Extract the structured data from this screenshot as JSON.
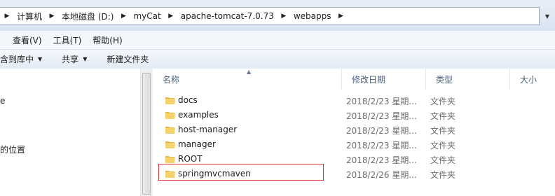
{
  "address_bar": {
    "crumbs": [
      "计算机",
      "本地磁盘 (D:)",
      "myCat",
      "apache-tomcat-7.0.73",
      "webapps"
    ]
  },
  "menu": {
    "view": "查看(V)",
    "tools": "工具(T)",
    "help": "帮助(H)"
  },
  "toolbar": {
    "include_in_library": "含到库中",
    "share": "共享",
    "new_folder": "新建文件夹"
  },
  "nav": {
    "item_1": "e",
    "item_2": "的位置"
  },
  "columns": {
    "name": "名称",
    "modified": "修改日期",
    "type": "类型",
    "size": "大小"
  },
  "files": [
    {
      "name": "docs",
      "modified": "2018/2/23 星期...",
      "type": "文件夹"
    },
    {
      "name": "examples",
      "modified": "2018/2/23 星期...",
      "type": "文件夹"
    },
    {
      "name": "host-manager",
      "modified": "2018/2/23 星期...",
      "type": "文件夹"
    },
    {
      "name": "manager",
      "modified": "2018/2/23 星期...",
      "type": "文件夹"
    },
    {
      "name": "ROOT",
      "modified": "2018/2/23 星期...",
      "type": "文件夹"
    },
    {
      "name": "springmvcmaven",
      "modified": "2018/2/26 星期...",
      "type": "文件夹"
    }
  ],
  "colors": {
    "highlight_border": "#e03b3b",
    "folder_yellow": "#f2c94c"
  }
}
